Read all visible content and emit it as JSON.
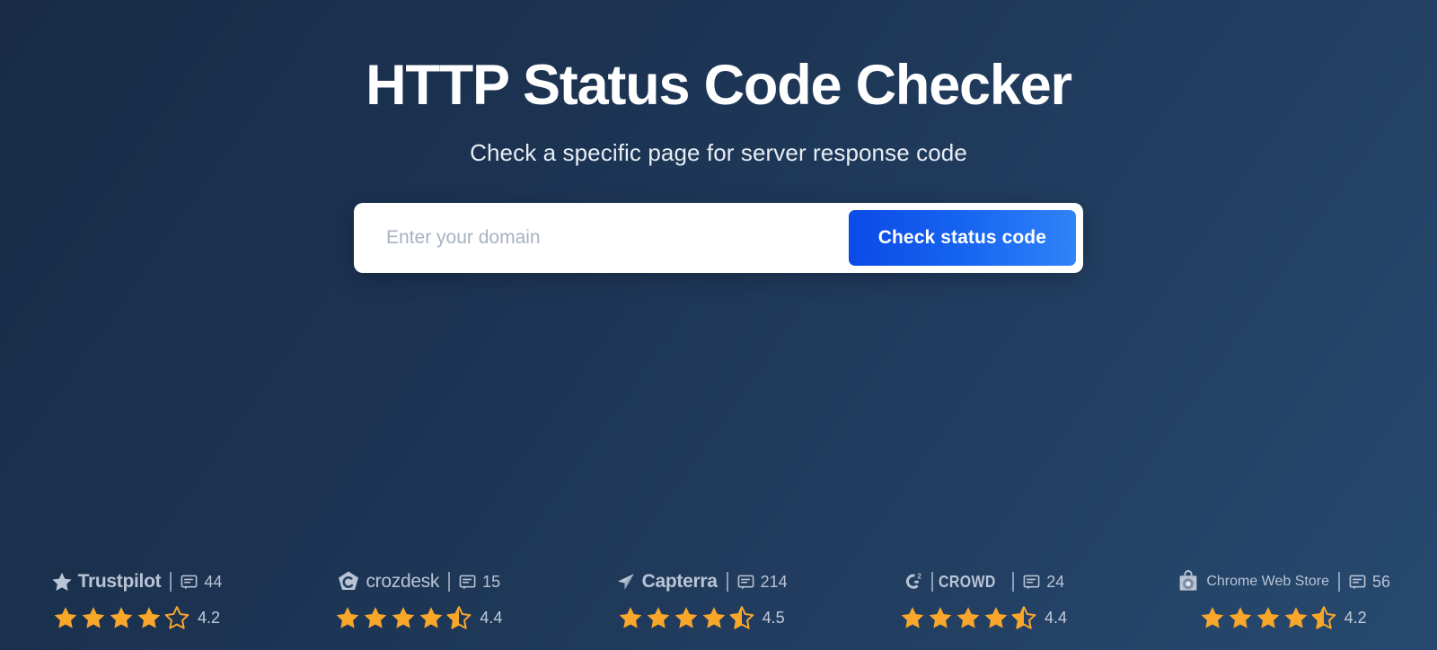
{
  "hero": {
    "title": "HTTP Status Code Checker",
    "subtitle": "Check a specific page for server response code"
  },
  "search": {
    "placeholder": "Enter your domain",
    "value": "",
    "button_label": "Check status code"
  },
  "colors": {
    "background_top": "#182c46",
    "background_bottom": "#27496f",
    "button_gradient_start": "#0b4ae6",
    "button_gradient_end": "#3083f8",
    "star_filled": "#f9a72b",
    "star_empty_outline": "#f9a72b",
    "brand_text": "#b9c4d4"
  },
  "reviews": [
    {
      "brand": "Trustpilot",
      "logo_icon": "star-icon",
      "reviews_icon": "comment-icon",
      "count": "44",
      "rating": "4.2",
      "stars_full": 4,
      "stars_half": 0,
      "stars_empty": 1
    },
    {
      "brand": "crozdesk",
      "logo_icon": "crozdesk-pentagon-icon",
      "reviews_icon": "comment-icon",
      "count": "15",
      "rating": "4.4",
      "stars_full": 4,
      "stars_half": 1,
      "stars_empty": 0
    },
    {
      "brand": "Capterra",
      "logo_icon": "paper-plane-icon",
      "reviews_icon": "comment-icon",
      "count": "214",
      "rating": "4.5",
      "stars_full": 4,
      "stars_half": 1,
      "stars_empty": 0
    },
    {
      "brand": "CROWD",
      "brand_prefix": "G",
      "brand_superscript": "2",
      "logo_icon": "g2-logo-icon",
      "reviews_icon": "comment-icon",
      "count": "24",
      "rating": "4.4",
      "stars_full": 4,
      "stars_half": 1,
      "stars_empty": 0
    },
    {
      "brand": "Chrome Web Store",
      "logo_icon": "chrome-web-store-bag-icon",
      "reviews_icon": "comment-icon",
      "count": "56",
      "rating": "4.2",
      "stars_full": 4,
      "stars_half": 1,
      "stars_empty": 0
    }
  ]
}
